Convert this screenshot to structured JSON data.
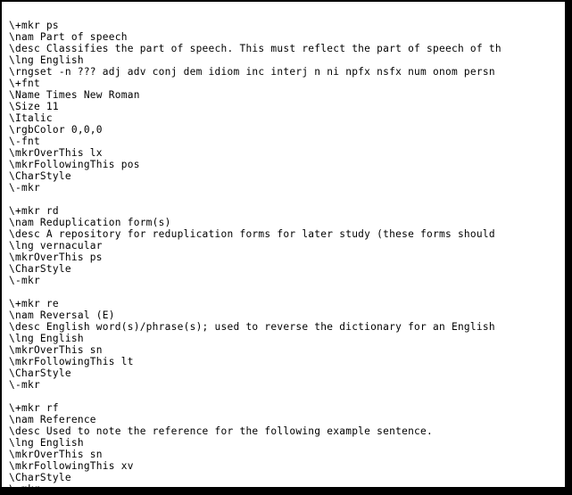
{
  "document": {
    "lines": [
      "\\+mkr ps",
      "\\nam Part of speech",
      "\\desc Classifies the part of speech. This must reflect the part of speech of th",
      "\\lng English",
      "\\rngset -n ??? adj adv conj dem idiom inc interj n ni npfx nsfx num onom persn",
      "\\+fnt",
      "\\Name Times New Roman",
      "\\Size 11",
      "\\Italic",
      "\\rgbColor 0,0,0",
      "\\-fnt",
      "\\mkrOverThis lx",
      "\\mkrFollowingThis pos",
      "\\CharStyle",
      "\\-mkr",
      "",
      "\\+mkr rd",
      "\\nam Reduplication form(s)",
      "\\desc A repository for reduplication forms for later study (these forms should",
      "\\lng vernacular",
      "\\mkrOverThis ps",
      "\\CharStyle",
      "\\-mkr",
      "",
      "\\+mkr re",
      "\\nam Reversal (E)",
      "\\desc English word(s)/phrase(s); used to reverse the dictionary for an English",
      "\\lng English",
      "\\mkrOverThis sn",
      "\\mkrFollowingThis lt",
      "\\CharStyle",
      "\\-mkr",
      "",
      "\\+mkr rf",
      "\\nam Reference",
      "\\desc Used to note the reference for the following example sentence.",
      "\\lng English",
      "\\mkrOverThis sn",
      "\\mkrFollowingThis xv",
      "\\CharStyle",
      "\\-mkr"
    ]
  }
}
